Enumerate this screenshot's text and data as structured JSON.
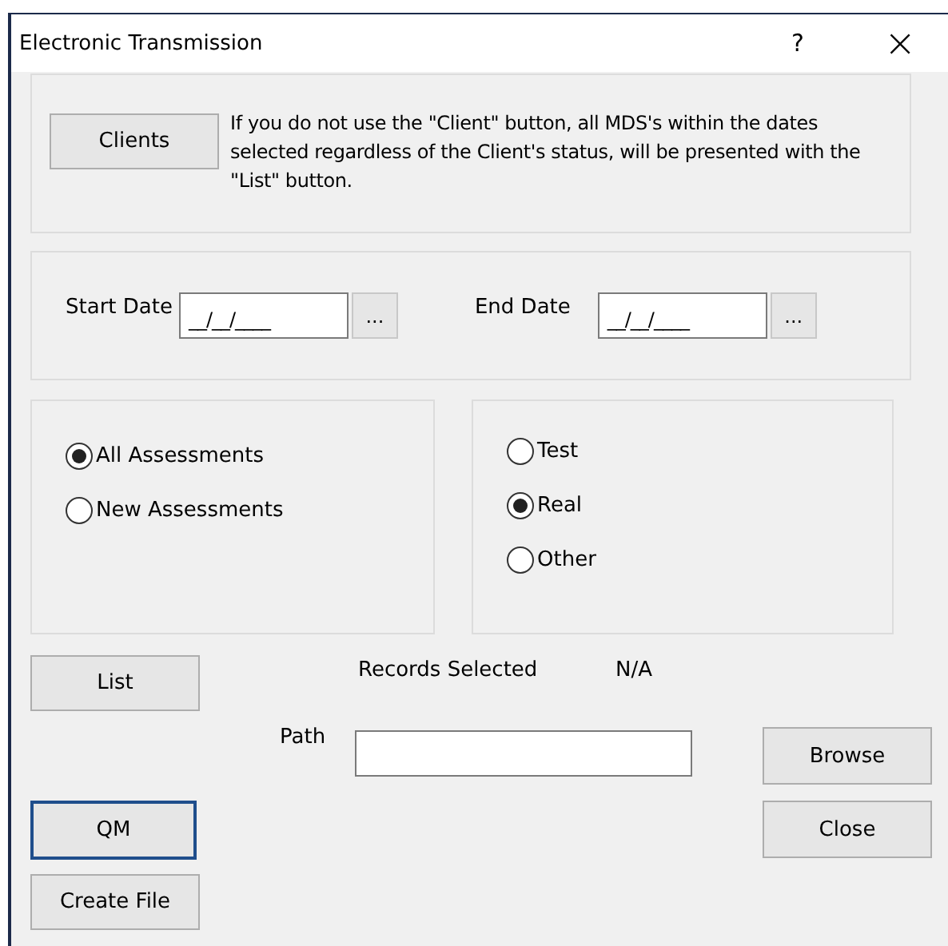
{
  "window": {
    "title": "Electronic Transmission",
    "help": "?",
    "close": "×"
  },
  "clients": {
    "button": "Clients",
    "note": "If you do not use the \"Client\" button, all MDS's within the dates selected regardless of the Client's status, will be presented with the \"List\" button."
  },
  "dates": [
    {
      "label": "Start Date",
      "value": "__/__/____",
      "picker": "..."
    },
    {
      "label": "End Date",
      "value": "__/__/____",
      "picker": "..."
    }
  ],
  "assessment_options": [
    {
      "label": "All Assessments",
      "selected": true
    },
    {
      "label": "New Assessments",
      "selected": false
    }
  ],
  "mode_options": [
    {
      "label": "Test",
      "selected": false
    },
    {
      "label": "Real",
      "selected": true
    },
    {
      "label": "Other",
      "selected": false
    }
  ],
  "list_button": "List",
  "records": {
    "label": "Records Selected",
    "value": "N/A"
  },
  "path": {
    "label": "Path"
  },
  "browse_button": "Browse",
  "qm_button": {
    "label": "QM",
    "focused": true
  },
  "close_button": "Close",
  "create_file_button": "Create File"
}
